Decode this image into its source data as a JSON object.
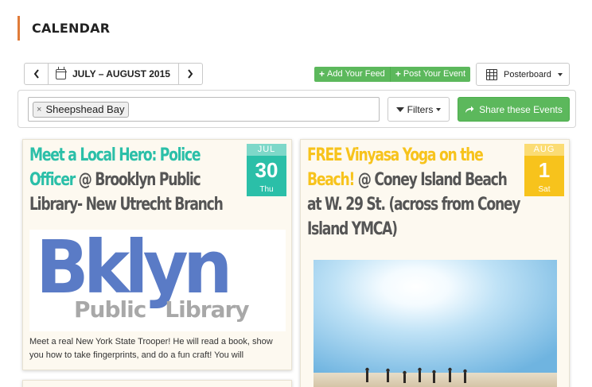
{
  "page": {
    "title": "CALENDAR"
  },
  "toolbar": {
    "date_range": "JULY – AUGUST 2015",
    "prev_label": "‹",
    "next_label": "›",
    "add_feed": "Add Your Feed",
    "post_event": "Post Your Event",
    "view_label": "Posterboard"
  },
  "filter_bar": {
    "tag": "Sheepshead Bay",
    "tag_remove": "×",
    "filters_label": "Filters",
    "share_label": "Share these Events"
  },
  "events": [
    {
      "name": "Meet a Local Hero: Police Officer",
      "venue": " @ Brooklyn Public Library- New Utrecht Branch",
      "month": "JUL",
      "day": "30",
      "weekday": "Thu",
      "logo_main": "Bklyn",
      "logo_sub_1": "Public",
      "logo_sub_2": "Library",
      "description": "Meet a real New York State Trooper! He will read a book, show you how to take fingerprints, and do a fun craft! You will",
      "accent": "#2bbfa8"
    },
    {
      "name": "FREE Vinyasa Yoga on the Beach!",
      "venue": " @ Coney Island Beach at W. 29 St. (across from Coney Island YMCA)",
      "month": "AUG",
      "day": "1",
      "weekday": "Sat",
      "accent": "#f7c31c"
    }
  ],
  "icons": {
    "calendar": "calendar-icon",
    "posterboard": "grid-icon",
    "share": "share-arrow-icon",
    "filter": "funnel-icon"
  },
  "colors": {
    "heading_accent": "#e07b39",
    "button_green": "#5cb85c"
  }
}
